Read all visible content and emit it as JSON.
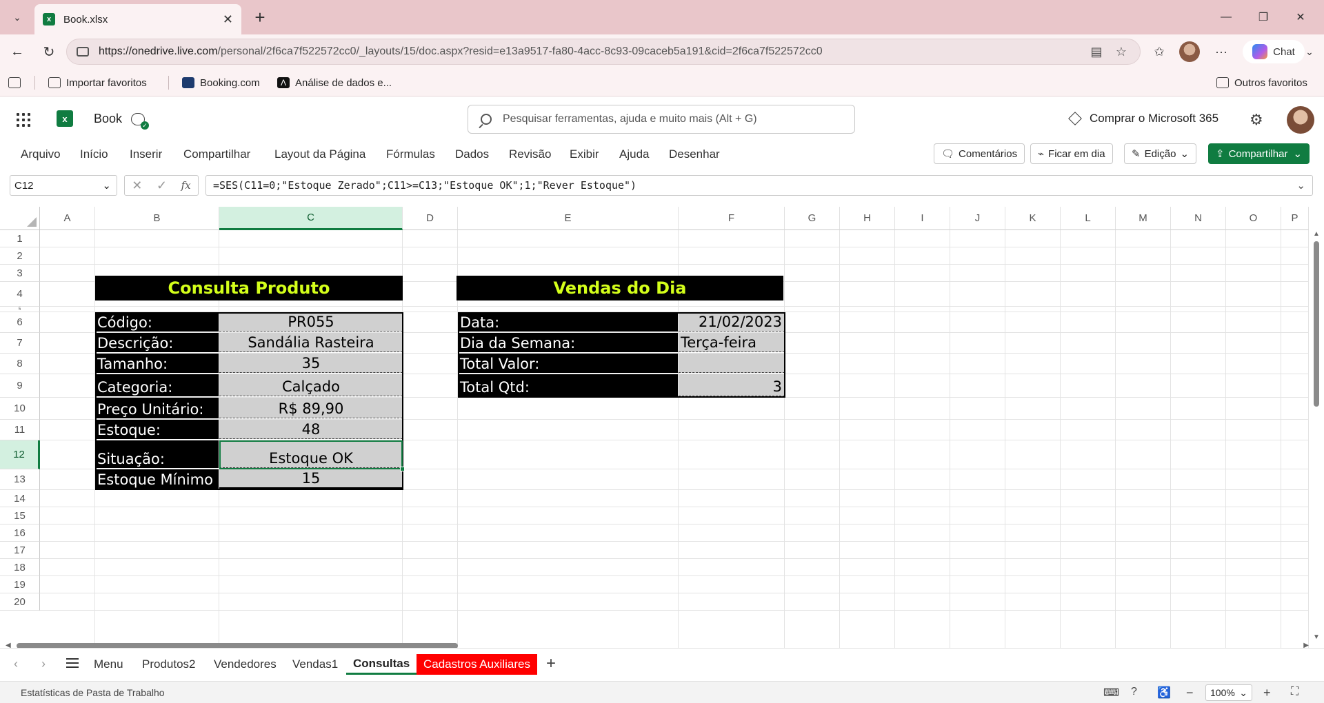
{
  "browser": {
    "tab_title": "Book.xlsx",
    "url_host": "https://onedrive.live.com",
    "url_path": "/personal/2f6ca7f522572cc0/_layouts/15/doc.aspx?resid=e13a9517-fa80-4acc-8c93-09caceb5a191&cid=2f6ca7f522572cc0",
    "copilot_label": "Chat",
    "favorites": [
      "Importar favoritos",
      "Booking.com",
      "Análise de dados e..."
    ],
    "other_favorites": "Outros favoritos"
  },
  "app": {
    "book_name": "Book",
    "search_placeholder": "Pesquisar ferramentas, ajuda e muito mais (Alt + G)",
    "buy_label": "Comprar o Microsoft 365",
    "accent_color": "#107c41"
  },
  "ribbon": {
    "menu": [
      "Arquivo",
      "Início",
      "Inserir",
      "Compartilhar",
      "Layout da Página",
      "Fórmulas",
      "Dados",
      "Revisão",
      "Exibir",
      "Ajuda",
      "Desenhar"
    ],
    "comments": "Comentários",
    "catch_up": "Ficar em dia",
    "editing": "Edição",
    "share": "Compartilhar"
  },
  "formula_bar": {
    "name_box": "C12",
    "formula": "=SES(C11=0;\"Estoque Zerado\";C11>=C13;\"Estoque OK\";1;\"Rever Estoque\")"
  },
  "grid": {
    "columns": [
      "A",
      "B",
      "C",
      "D",
      "E",
      "F",
      "G",
      "H",
      "I",
      "J",
      "K",
      "L",
      "M",
      "N",
      "O",
      "P"
    ],
    "rows": [
      "1",
      "2",
      "3",
      "4",
      "5",
      "6",
      "7",
      "8",
      "9",
      "10",
      "11",
      "12",
      "13",
      "14",
      "15",
      "16",
      "17",
      "18",
      "19",
      "20"
    ],
    "selected_cell": "C12"
  },
  "consulta": {
    "title": "Consulta Produto",
    "labels": [
      "Código:",
      "Descrição:",
      "Tamanho:",
      "Categoria:",
      "Preço Unitário:",
      "Estoque:",
      "Situação:",
      "Estoque Mínimo"
    ],
    "values": [
      "PR055",
      "Sandália Rasteira",
      "35",
      "Calçado",
      "R$ 89,90",
      "48",
      "Estoque OK",
      "15"
    ]
  },
  "vendas": {
    "title": "Vendas do Dia",
    "labels": [
      "Data:",
      "Dia da Semana:",
      "Total Valor:",
      "Total Qtd:"
    ],
    "values": [
      "21/02/2023",
      "Terça-feira",
      "",
      "3"
    ]
  },
  "sheets": {
    "tabs": [
      "Menu",
      "Produtos2",
      "Vendedores",
      "Vendas1",
      "Consultas",
      "Cadastros Auxiliares"
    ],
    "active": "Consultas"
  },
  "status": {
    "text": "Estatísticas de Pasta de Trabalho",
    "zoom": "100%"
  }
}
